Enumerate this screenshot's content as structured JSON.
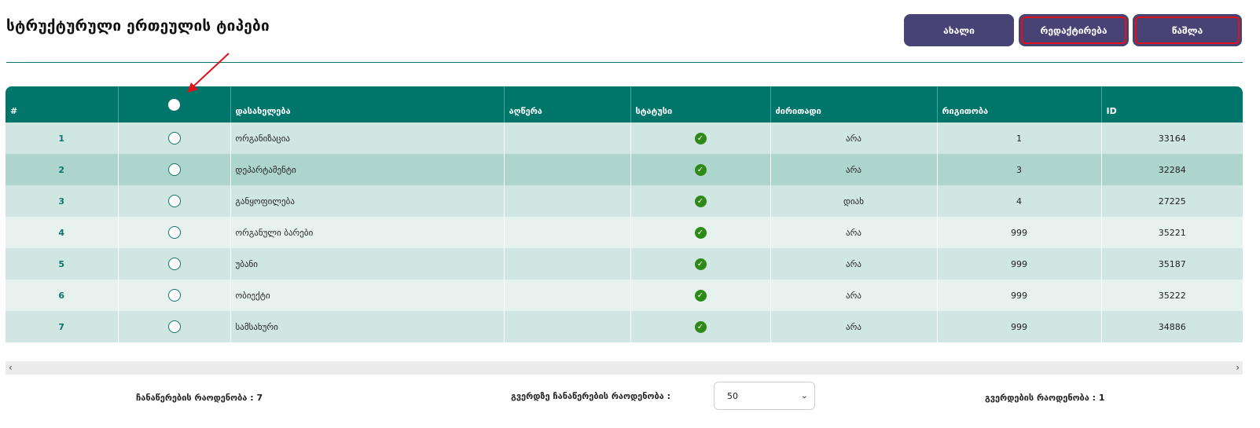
{
  "page": {
    "title": "სტრუქტურული ერთეულის ტიპები"
  },
  "header_buttons": {
    "new_label": "ახალი",
    "edit_label": "რედაქტირება",
    "delete_label": "წაშლა"
  },
  "table": {
    "columns": [
      "#",
      "",
      "დასახელება",
      "აღწერა",
      "სტატუსი",
      "ძირითადი",
      "რიგითობა",
      "ID"
    ],
    "rows": [
      {
        "num": "1",
        "name": "ორგანიზაცია",
        "description": "",
        "main": "არა",
        "order": "1",
        "id": "33164"
      },
      {
        "num": "2",
        "name": "დეპარტამენტი",
        "description": "",
        "main": "არა",
        "order": "3",
        "id": "32284"
      },
      {
        "num": "3",
        "name": "განყოფილება",
        "description": "",
        "main": "დიახ",
        "order": "4",
        "id": "27225"
      },
      {
        "num": "4",
        "name": "ორგანული ბარები",
        "description": "",
        "main": "არა",
        "order": "999",
        "id": "35221"
      },
      {
        "num": "5",
        "name": "უბანი",
        "description": "",
        "main": "არა",
        "order": "999",
        "id": "35187"
      },
      {
        "num": "6",
        "name": "ობიექტი",
        "description": "",
        "main": "არა",
        "order": "999",
        "id": "35222"
      },
      {
        "num": "7",
        "name": "სამსახური",
        "description": "",
        "main": "არა",
        "order": "999",
        "id": "34886"
      }
    ],
    "status_icon": "check-circle-icon"
  },
  "footer": {
    "records_count": "ჩანაწერების რაოდენობა : 7",
    "per_page_label": "გვერდზე ჩანაწერების რაოდენობა :",
    "per_page_value": "50",
    "pages_count": "გვერდების რაოდენობა : 1"
  },
  "colors": {
    "header_bg": "#00766a",
    "button_bg": "#474375",
    "highlight": "#e1111b",
    "status_ok": "#2e8a16"
  }
}
